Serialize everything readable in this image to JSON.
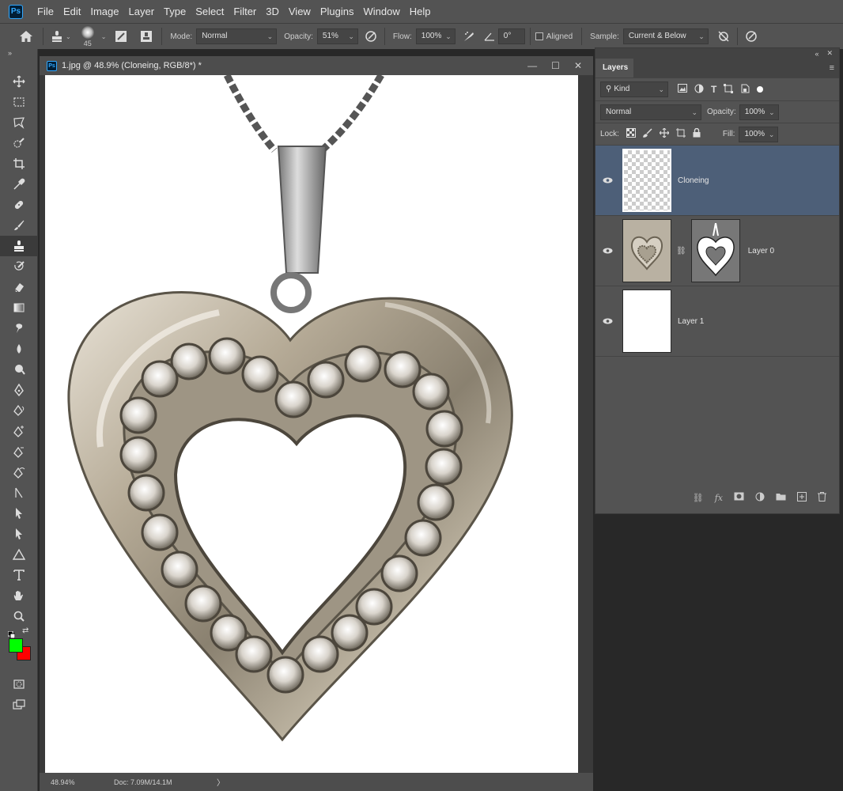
{
  "app": {
    "logo": "Ps"
  },
  "menu": [
    "File",
    "Edit",
    "Image",
    "Layer",
    "Type",
    "Select",
    "Filter",
    "3D",
    "View",
    "Plugins",
    "Window",
    "Help"
  ],
  "options": {
    "brush_size": "45",
    "mode_label": "Mode:",
    "mode_value": "Normal",
    "opacity_label": "Opacity:",
    "opacity_value": "51%",
    "flow_label": "Flow:",
    "flow_value": "100%",
    "angle_value": "0°",
    "aligned_label": "Aligned",
    "sample_label": "Sample:",
    "sample_value": "Current & Below"
  },
  "toolbar": {
    "collapse": "»"
  },
  "colors": {
    "foreground": "#00ff00",
    "background": "#ff0000",
    "accent": "#31a8ff",
    "selected_layer": "#4d5f78"
  },
  "document": {
    "title": "1.jpg @ 48.9% (Cloneing, RGB/8*) *",
    "zoom": "48.94%",
    "doc_info": "Doc: 7.09M/14.1M",
    "status_arrow": "〉"
  },
  "layers_panel": {
    "tab": "Layers",
    "kind_label": "Kind",
    "blend_mode": "Normal",
    "opacity_label": "Opacity:",
    "opacity_value": "100%",
    "lock_label": "Lock:",
    "fill_label": "Fill:",
    "fill_value": "100%",
    "layers": [
      {
        "name": "Cloneing"
      },
      {
        "name": "Layer 0"
      },
      {
        "name": "Layer 1"
      }
    ]
  }
}
